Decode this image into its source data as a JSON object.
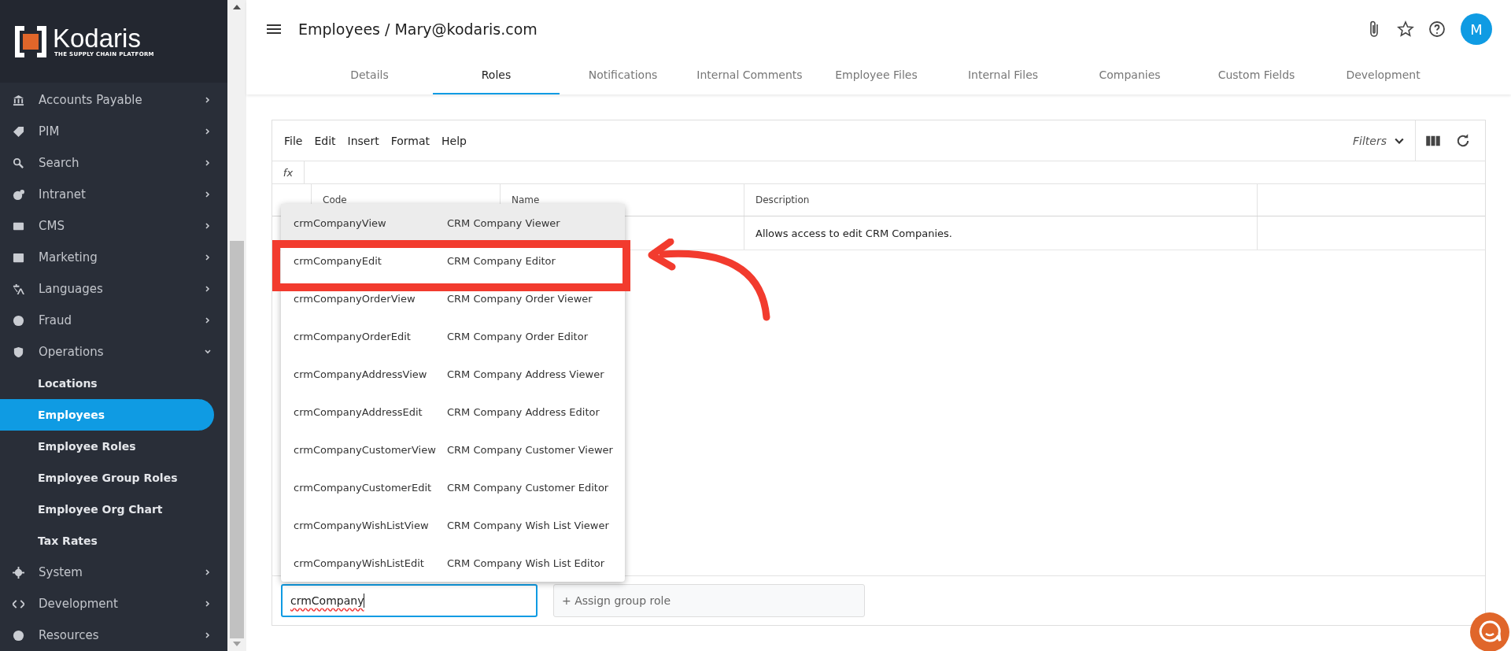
{
  "sidebar": {
    "logo": {
      "name": "Kodaris",
      "tagline": "THE SUPPLY CHAIN PLATFORM"
    },
    "items": [
      {
        "label": "Accounts Payable",
        "expanded": false
      },
      {
        "label": "PIM",
        "expanded": false
      },
      {
        "label": "Search",
        "expanded": false
      },
      {
        "label": "Intranet",
        "expanded": false
      },
      {
        "label": "CMS",
        "expanded": false
      },
      {
        "label": "Marketing",
        "expanded": false
      },
      {
        "label": "Languages",
        "expanded": false
      },
      {
        "label": "Fraud",
        "expanded": false
      },
      {
        "label": "Operations",
        "expanded": true,
        "children": [
          {
            "label": "Locations",
            "selected": false
          },
          {
            "label": "Employees",
            "selected": true
          },
          {
            "label": "Employee Roles",
            "selected": false
          },
          {
            "label": "Employee Group Roles",
            "selected": false
          },
          {
            "label": "Employee Org Chart",
            "selected": false
          },
          {
            "label": "Tax Rates",
            "selected": false
          }
        ]
      },
      {
        "label": "System",
        "expanded": false
      },
      {
        "label": "Development",
        "expanded": false
      },
      {
        "label": "Resources",
        "expanded": false
      }
    ]
  },
  "header": {
    "title": "Employees / Mary@kodaris.com",
    "avatar": "M"
  },
  "tabs": [
    {
      "label": "Details",
      "selected": false
    },
    {
      "label": "Roles",
      "selected": true
    },
    {
      "label": "Notifications",
      "selected": false
    },
    {
      "label": "Internal Comments",
      "selected": false
    },
    {
      "label": "Employee Files",
      "selected": false
    },
    {
      "label": "Internal Files",
      "selected": false
    },
    {
      "label": "Companies",
      "selected": false
    },
    {
      "label": "Custom Fields",
      "selected": false
    },
    {
      "label": "Development",
      "selected": false
    }
  ],
  "grid": {
    "menu": [
      "File",
      "Edit",
      "Insert",
      "Format",
      "Help"
    ],
    "filters": "Filters",
    "formula_label": "fx",
    "columns": [
      "Code",
      "Name",
      "Description"
    ],
    "rows": [
      {
        "description": "Allows access to edit CRM Companies."
      }
    ]
  },
  "dropdown": {
    "options": [
      {
        "code": "crmCompanyView",
        "name": "CRM Company Viewer",
        "highlighted": false,
        "selected": true
      },
      {
        "code": "crmCompanyEdit",
        "name": "CRM Company Editor",
        "highlighted": true,
        "selected": false
      },
      {
        "code": "crmCompanyOrderView",
        "name": "CRM Company Order Viewer",
        "highlighted": false,
        "selected": false
      },
      {
        "code": "crmCompanyOrderEdit",
        "name": "CRM Company Order Editor",
        "highlighted": false,
        "selected": false
      },
      {
        "code": "crmCompanyAddressView",
        "name": "CRM Company Address Viewer",
        "highlighted": false,
        "selected": false
      },
      {
        "code": "crmCompanyAddressEdit",
        "name": "CRM Company Address Editor",
        "highlighted": false,
        "selected": false
      },
      {
        "code": "crmCompanyCustomerView",
        "name": "CRM Company Customer Viewer",
        "highlighted": false,
        "selected": false
      },
      {
        "code": "crmCompanyCustomerEdit",
        "name": "CRM Company Customer Editor",
        "highlighted": false,
        "selected": false
      },
      {
        "code": "crmCompanyWishListView",
        "name": "CRM Company Wish List Viewer",
        "highlighted": false,
        "selected": false
      },
      {
        "code": "crmCompanyWishListEdit",
        "name": "CRM Company Wish List Editor",
        "highlighted": false,
        "selected": false
      }
    ]
  },
  "role_input": {
    "value": "crmCompany"
  },
  "group_role_input": {
    "placeholder": "+ Assign group role"
  }
}
